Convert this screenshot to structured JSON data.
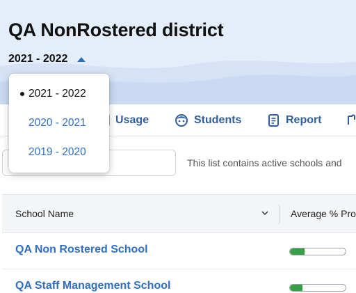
{
  "header": {
    "district_title": "QA NonRostered district",
    "school_year": "2021 - 2022"
  },
  "year_dropdown": {
    "selected": "2021 - 2022",
    "options": [
      "2020 - 2021",
      "2019 - 2020"
    ]
  },
  "tabs": [
    {
      "label": "Usage",
      "icon": "usage-icon"
    },
    {
      "label": "Students",
      "icon": "student-face-icon"
    },
    {
      "label": "Report",
      "icon": "report-icon"
    }
  ],
  "toolbar": {
    "search_value": "",
    "info_text": "This list contains active schools and"
  },
  "table": {
    "columns": [
      "School Name",
      "Average % Pro"
    ],
    "rows": [
      {
        "name": "QA Non Rostered School",
        "progress": 0.26
      },
      {
        "name": "QA Staff Management School",
        "progress": 0.22
      }
    ]
  },
  "colors": {
    "accent": "#2f6fc2",
    "tab_text": "#2f5f9e",
    "header_bg": "#e4eefb",
    "progress_fill": "#37a046"
  }
}
